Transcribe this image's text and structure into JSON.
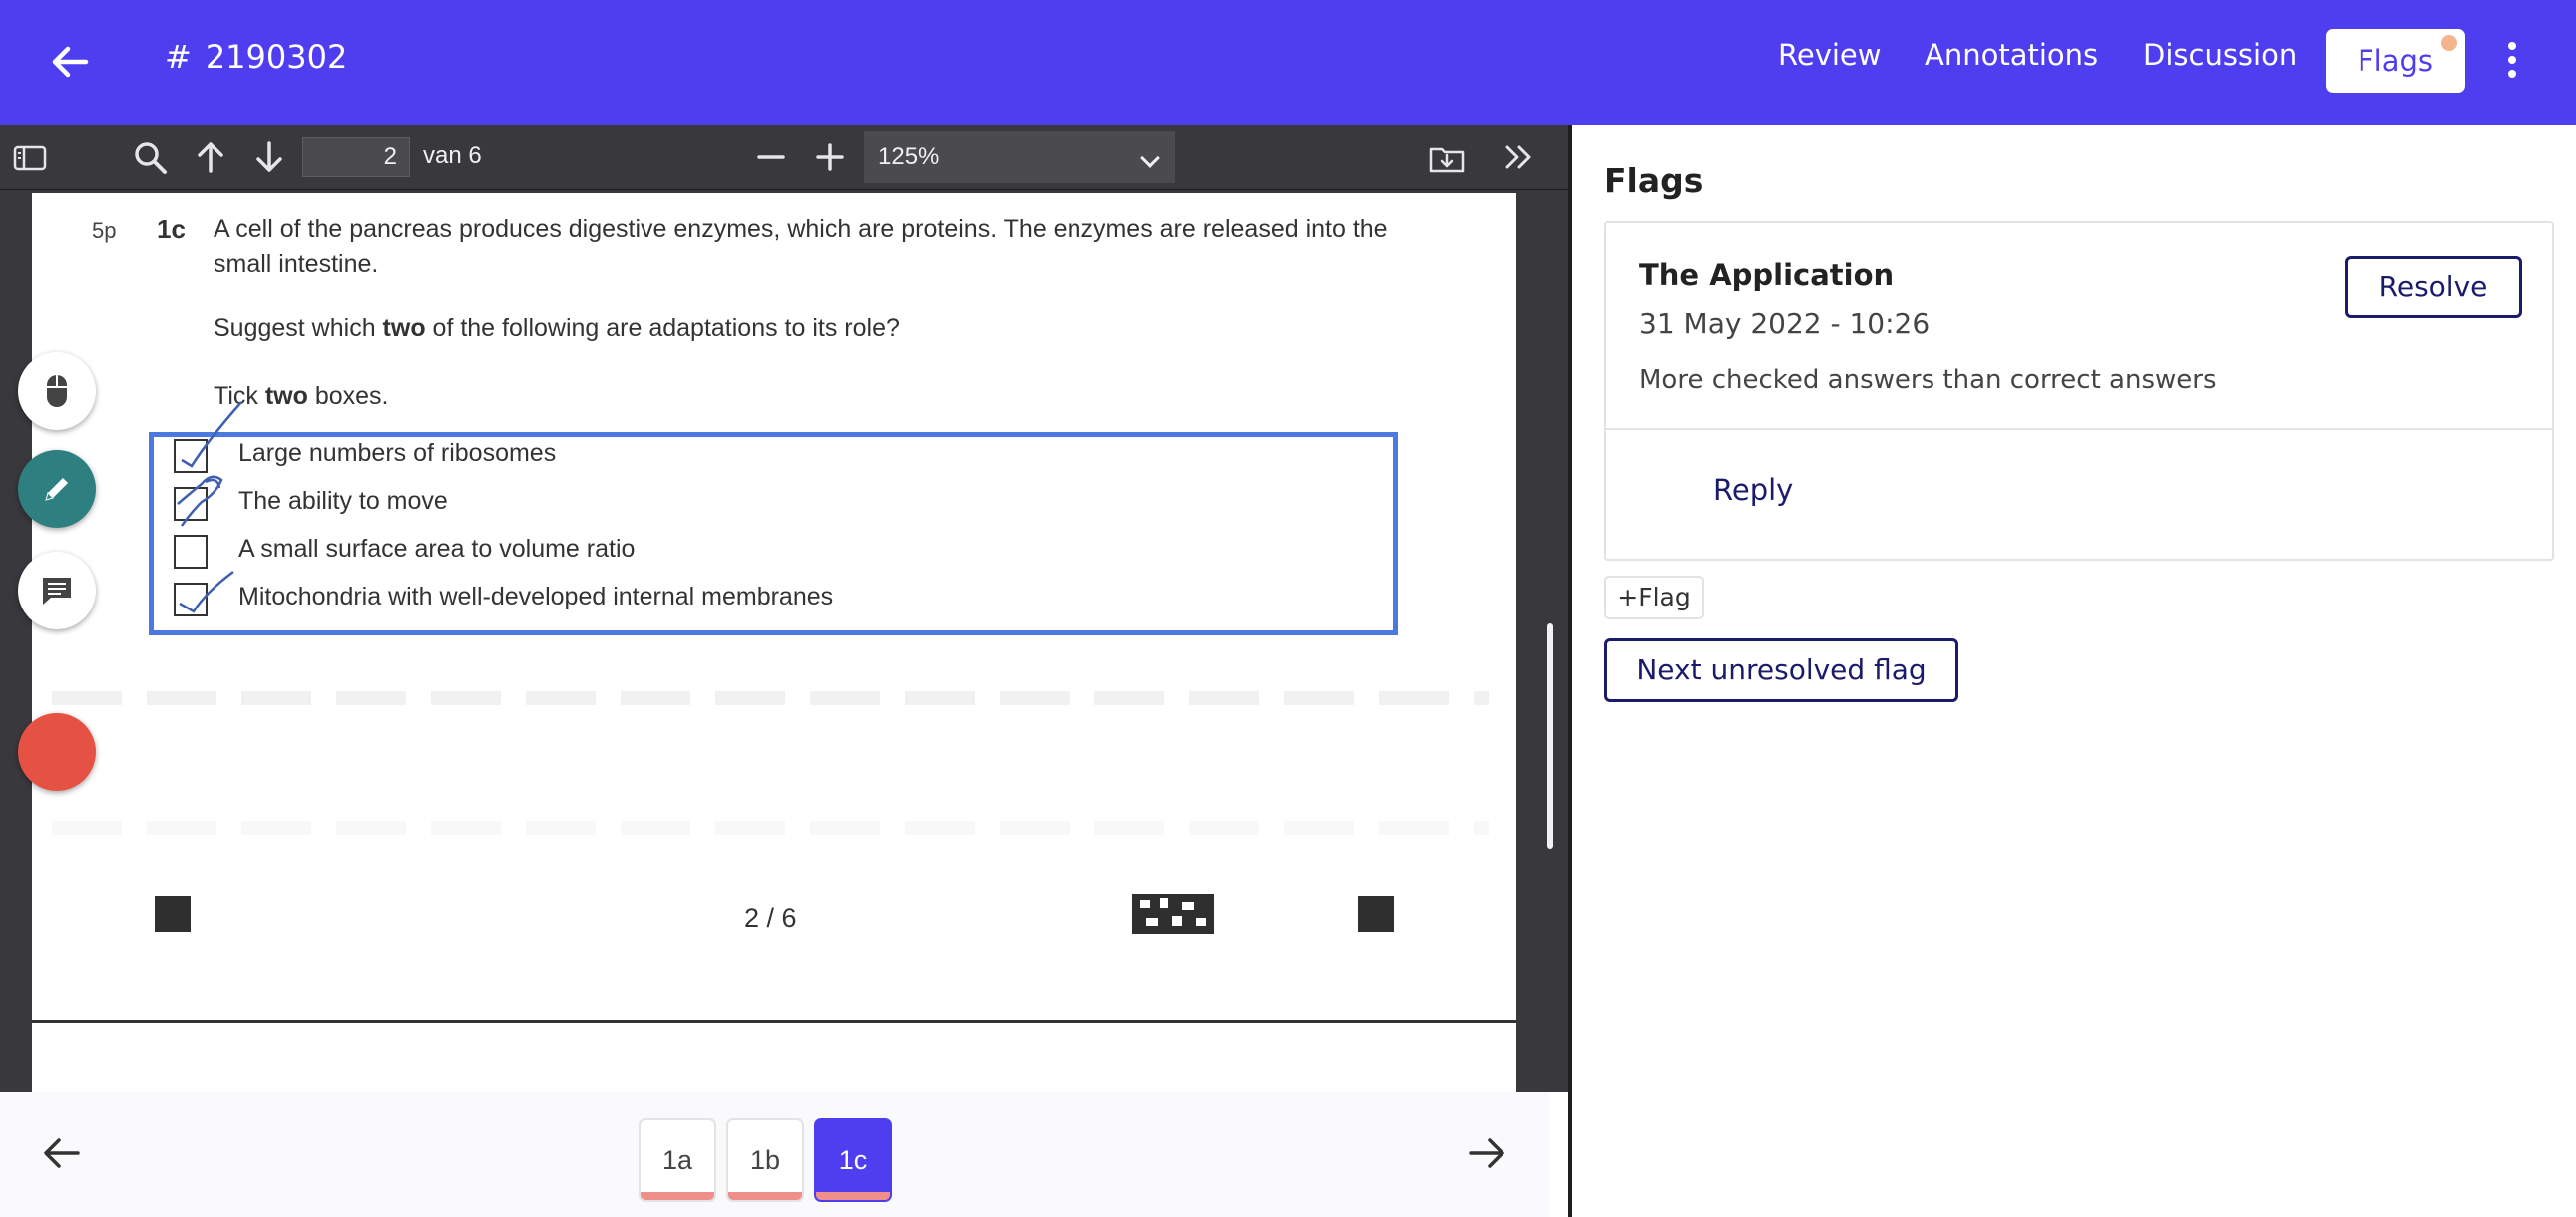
{
  "header": {
    "hash": "#",
    "exam_id": "2190302",
    "tabs": [
      {
        "label": "Review"
      },
      {
        "label": "Annotations"
      },
      {
        "label": "Discussion"
      },
      {
        "label": "Flags",
        "active": true
      }
    ],
    "colors": {
      "bar": "#4f3df0",
      "notification_dot": "#f4b48e"
    }
  },
  "pdf_toolbar": {
    "page_number": "2",
    "page_of": "van 6",
    "zoom": "125%"
  },
  "question": {
    "marks": "5p",
    "number": "1c",
    "text": "A cell of the pancreas produces digestive enzymes, which are proteins. The enzymes are released into the small intestine.",
    "prompt_before": "Suggest which ",
    "prompt_bold": "two",
    "prompt_after": " of the following are adaptations to its role?",
    "tick_before": "Tick ",
    "tick_bold": "two",
    "tick_after": " boxes.",
    "options": [
      {
        "label": "Large numbers of ribosomes",
        "checked": true
      },
      {
        "label": "The ability to move",
        "checked": true
      },
      {
        "label": "A small surface area to volume ratio",
        "checked": false
      },
      {
        "label": "Mitochondria with well-developed internal membranes",
        "checked": true
      }
    ],
    "page_footer": "2 / 6"
  },
  "bottom_nav": {
    "questions": [
      {
        "label": "1a",
        "active": false
      },
      {
        "label": "1b",
        "active": false
      },
      {
        "label": "1c",
        "active": true
      }
    ]
  },
  "flags_panel": {
    "title": "Flags",
    "flags": [
      {
        "author": "The Application",
        "date": "31 May 2022 - 10:26",
        "message": "More checked answers than correct answers",
        "resolve_label": "Resolve",
        "reply_label": "Reply"
      }
    ],
    "add_flag_label": "+Flag",
    "next_unresolved_label": "Next unresolved flag"
  }
}
